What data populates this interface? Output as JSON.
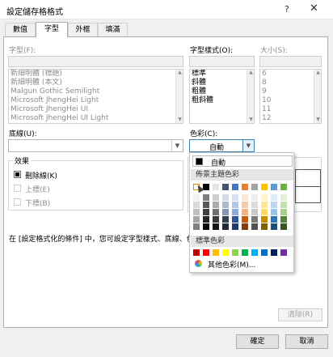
{
  "window": {
    "title": "設定儲存格格式",
    "help_icon": "?",
    "close_icon": "✕"
  },
  "tabs": [
    {
      "label": "數值"
    },
    {
      "label": "字型"
    },
    {
      "label": "外框"
    },
    {
      "label": "填滿"
    }
  ],
  "font": {
    "font_label": "字型(F):",
    "style_label": "字型樣式(O):",
    "size_label": "大小(S):",
    "font_list": [
      "新細明體 (標題)",
      "新細明體 (本文)",
      "Malgun Gothic Semilight",
      "Microsoft JhengHei Light",
      "Microsoft JhengHei UI",
      "Microsoft JhengHei UI Light"
    ],
    "style_list": [
      "標準",
      "斜體",
      "粗體",
      "粗斜體"
    ],
    "size_list": [
      "6",
      "8",
      "9",
      "10",
      "11",
      "12"
    ]
  },
  "underline_label": "底線(U):",
  "color_label": "色彩(C):",
  "color_value": "自動",
  "effects": {
    "label": "效果",
    "strikethrough": "刪除線(K)",
    "superscript": "上標(E)",
    "subscript": "下標(B)"
  },
  "info_text": "在 [設定格式化的條件] 中，您可設定字型樣式、底線、色彩",
  "color_popup": {
    "auto_label": "自動",
    "theme_header": "佈景主題色彩",
    "standard_header": "標準色彩",
    "more_colors": "其他色彩(M)...",
    "theme_colors": [
      "#ffffff",
      "#000000",
      "#e7e6e6",
      "#44546a",
      "#4472c4",
      "#ed7d31",
      "#a5a5a5",
      "#ffc000",
      "#5b9bd5",
      "#70ad47"
    ],
    "theme_tints": [
      [
        "#f2f2f2",
        "#7f7f7f",
        "#d0cece",
        "#d6dce4",
        "#d9e2f3",
        "#fbe5d5",
        "#ededed",
        "#fff2cc",
        "#deebf6",
        "#e2efd9"
      ],
      [
        "#d8d8d8",
        "#595959",
        "#aeabab",
        "#adb9ca",
        "#b4c6e7",
        "#f7caac",
        "#dbdbdb",
        "#fee599",
        "#bdd7ee",
        "#c5e0b3"
      ],
      [
        "#bfbfbf",
        "#3f3f3f",
        "#757070",
        "#8496b0",
        "#8eaadb",
        "#f4b183",
        "#c9c9c9",
        "#ffd965",
        "#9cc3e5",
        "#a8d08d"
      ],
      [
        "#a5a5a5",
        "#262626",
        "#3a3838",
        "#323f4f",
        "#2f5496",
        "#c55a11",
        "#7b7b7b",
        "#bf8f00",
        "#2e75b5",
        "#538135"
      ],
      [
        "#7f7f7f",
        "#0c0c0c",
        "#171616",
        "#222a35",
        "#1f3864",
        "#833c0b",
        "#525252",
        "#7f6000",
        "#1e4e79",
        "#375623"
      ]
    ],
    "standard_colors": [
      "#c00000",
      "#ff0000",
      "#ffc000",
      "#ffff00",
      "#92d050",
      "#00b050",
      "#00b0f0",
      "#0070c0",
      "#002060",
      "#7030a0"
    ]
  },
  "clear_button": "清除(R)",
  "ok_button": "確定",
  "cancel_button": "取消"
}
